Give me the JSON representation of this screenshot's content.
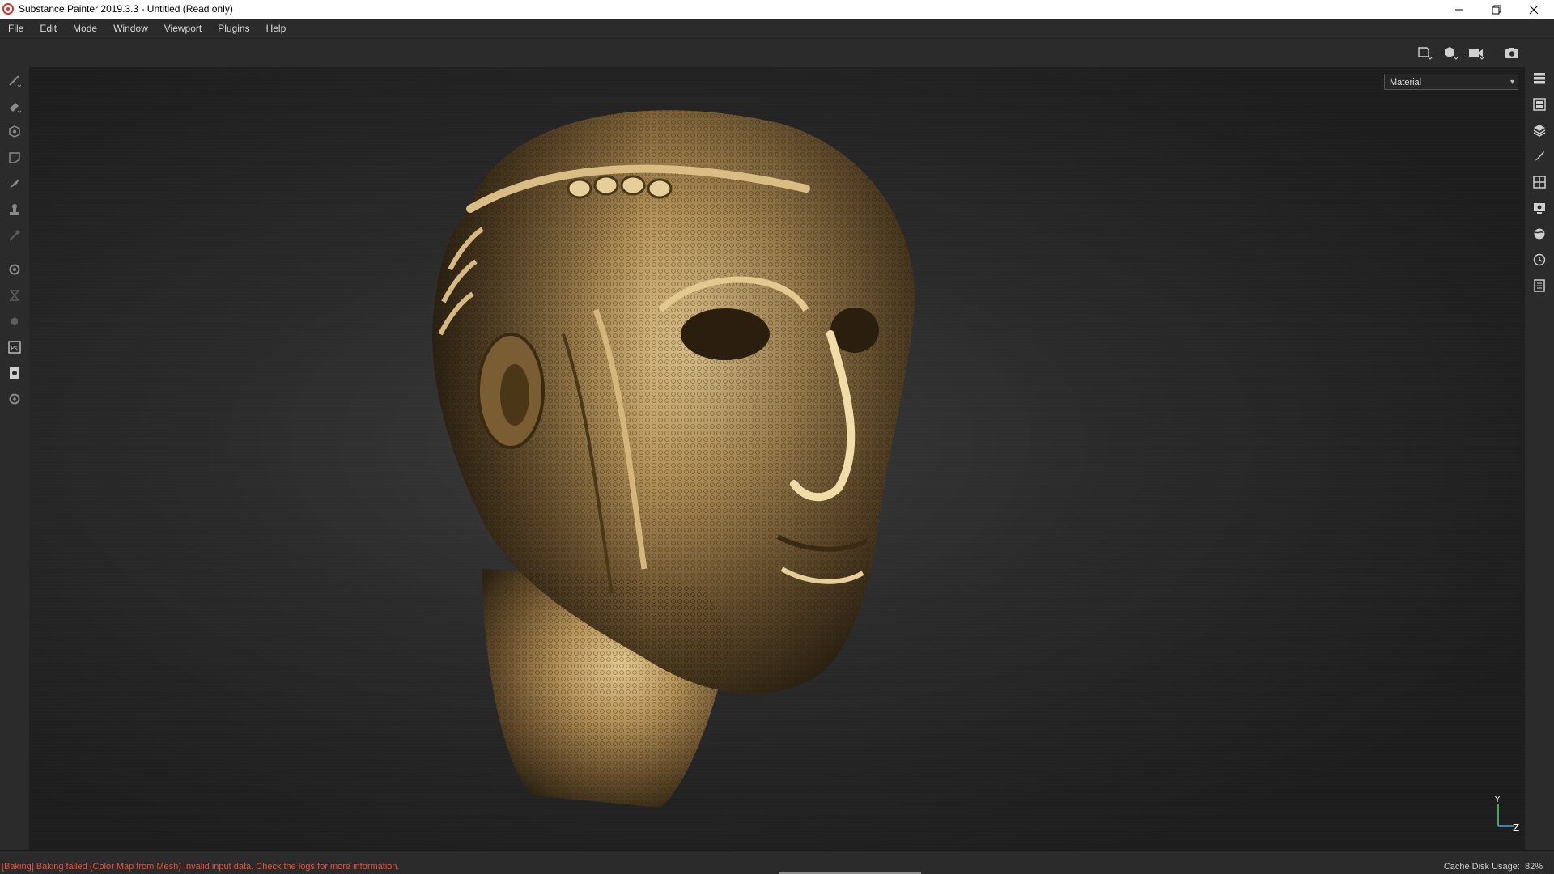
{
  "window": {
    "title": "Substance Painter 2019.3.3 - Untitled (Read only)",
    "controls": [
      "minimize-icon",
      "restore-icon",
      "close-icon"
    ]
  },
  "menu": {
    "items": [
      {
        "label": "File"
      },
      {
        "label": "Edit"
      },
      {
        "label": "Mode"
      },
      {
        "label": "Window"
      },
      {
        "label": "Viewport"
      },
      {
        "label": "Plugins"
      },
      {
        "label": "Help"
      }
    ]
  },
  "toolbar": {
    "icons": [
      "object-view-icon",
      "cube-view-icon",
      "camera-icon",
      "screenshot-icon"
    ]
  },
  "left_tools": [
    "paint-brush-icon",
    "eraser-icon",
    "projection-icon",
    "polygon-fill-icon",
    "smudge-icon",
    "clone-stamp-icon",
    "color-picker-icon",
    "bake-settings-icon",
    "iray-icon",
    "effects-icon",
    "photoshop-icon",
    "export-icon",
    "plugin-icon"
  ],
  "right_tools": [
    "layers-icon",
    "texture-set-list-icon",
    "texture-set-settings-icon",
    "brush-properties-icon",
    "shelf-icon",
    "display-settings-icon",
    "environment-icon",
    "history-icon",
    "log-icon"
  ],
  "viewport": {
    "mode_select": "Material",
    "axis_labels": {
      "y": "Y",
      "z": "Z"
    }
  },
  "status": {
    "message": "[Baking] Baking failed (Color Map from Mesh) Invalid input data. Check the logs for more information.",
    "cache_label": "Cache Disk Usage:",
    "cache_value": "82%"
  },
  "colors": {
    "error": "#e4523b",
    "panel": "#2b2b2b",
    "bronze": "#b8955a"
  }
}
